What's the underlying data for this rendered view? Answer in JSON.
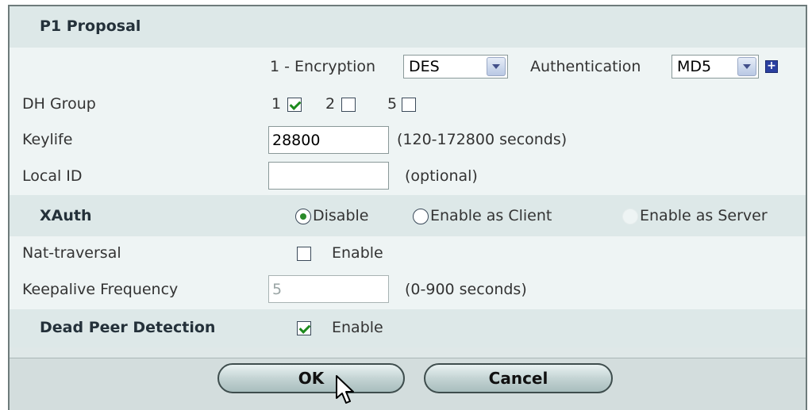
{
  "section_title": "P1 Proposal",
  "proposal": {
    "encryption_label": "1 - Encryption",
    "encryption_value": "DES",
    "authentication_label": "Authentication",
    "authentication_value": "MD5"
  },
  "dh_group": {
    "label": "DH Group",
    "options": [
      {
        "label": "1",
        "checked": true
      },
      {
        "label": "2",
        "checked": false
      },
      {
        "label": "5",
        "checked": false
      }
    ]
  },
  "keylife": {
    "label": "Keylife",
    "value": "28800",
    "hint": "(120-172800 seconds)"
  },
  "local_id": {
    "label": "Local ID",
    "value": "",
    "hint": "(optional)"
  },
  "xauth": {
    "label": "XAuth",
    "options": [
      "Disable",
      "Enable as Client",
      "Enable as Server"
    ],
    "selected": "Disable"
  },
  "nat_traversal": {
    "label": "Nat-traversal",
    "option_label": "Enable",
    "checked": false
  },
  "keepalive": {
    "label": "Keepalive Frequency",
    "value": "5",
    "hint": "(0-900 seconds)"
  },
  "dpd": {
    "label": "Dead Peer Detection",
    "option_label": "Enable",
    "checked": true
  },
  "buttons": {
    "ok": "OK",
    "cancel": "Cancel"
  }
}
